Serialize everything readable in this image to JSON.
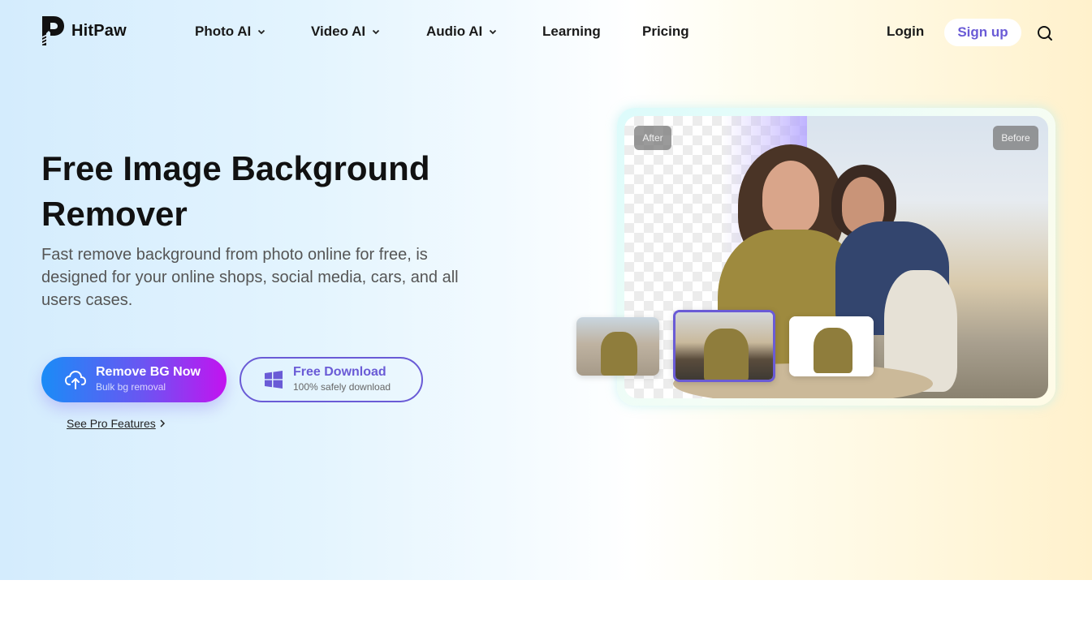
{
  "brand": {
    "name": "HitPaw",
    "logo_icon": "hitpaw-logo-icon"
  },
  "nav": {
    "items": [
      {
        "label": "Photo AI",
        "has_dropdown": true
      },
      {
        "label": "Video AI",
        "has_dropdown": true
      },
      {
        "label": "Audio AI",
        "has_dropdown": true
      },
      {
        "label": "Learning",
        "has_dropdown": false
      },
      {
        "label": "Pricing",
        "has_dropdown": false
      }
    ],
    "login_label": "Login",
    "signup_label": "Sign up",
    "search_icon": "search-icon"
  },
  "hero": {
    "title": "Free Image Background Remover",
    "subtitle": "Fast remove background from photo online for free, is designed for your online shops, social media, cars, and all users cases.",
    "primary_button": {
      "label": "Remove BG Now",
      "sublabel": "Bulk bg removal",
      "icon": "cloud-upload-icon"
    },
    "secondary_button": {
      "label": "Free Download",
      "sublabel": "100% safely download",
      "icon": "windows-icon"
    },
    "pro_link": {
      "label": "See Pro Features",
      "icon": "chevron-right-icon"
    }
  },
  "showcase": {
    "after_label": "After",
    "before_label": "Before",
    "thumbnails": [
      {
        "name": "desert-background",
        "selected": false
      },
      {
        "name": "sunset-background",
        "selected": true
      },
      {
        "name": "white-background",
        "selected": false
      }
    ]
  },
  "colors": {
    "accent": "#6a5bd6",
    "primary_gradient_start": "#1a8cf7",
    "primary_gradient_end": "#c313f0",
    "text_dark": "#111111",
    "text_muted": "#555555"
  }
}
